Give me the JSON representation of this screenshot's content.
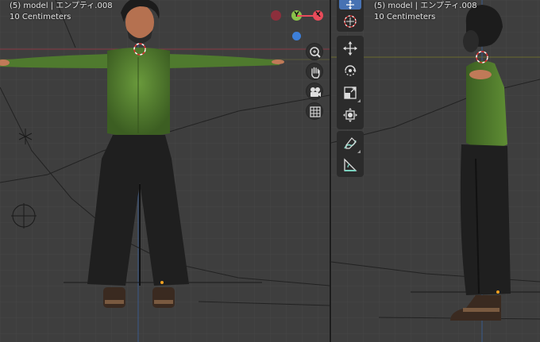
{
  "front_view": {
    "object_info": "(5) model | エンプティ.008",
    "grid_scale": "10 Centimeters"
  },
  "side_view": {
    "object_info": "(5) model | エンプティ.008",
    "grid_scale": "10 Centimeters"
  },
  "axis_gizmo": {
    "y_label": "Y",
    "x_label": "X",
    "colors": {
      "x": "#e84b5a",
      "y": "#8bc34a",
      "z": "#3d7fd9",
      "neg_x": "#8c2f3c"
    }
  },
  "navigation": [
    "zoom-icon",
    "hand-pan-icon",
    "camera-icon",
    "grid-ortho-icon"
  ],
  "tools": [
    "move-tool-icon",
    "cursor-tool-icon",
    "move-icon",
    "rotate-icon",
    "scale-icon",
    "transform-icon",
    "annotate-icon",
    "measure-icon"
  ],
  "colors": {
    "viewport_bg": "#3e3e3e",
    "grid_line": "#4a4a4a",
    "active_tool": "#4772b3",
    "sweater": "#4f7a2e",
    "pants": "#1f1f1f",
    "skin": "#c07a58"
  }
}
